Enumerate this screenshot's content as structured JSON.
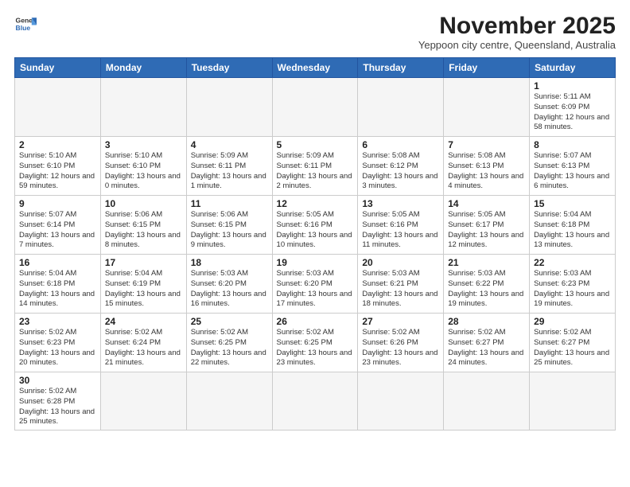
{
  "logo": {
    "line1": "General",
    "line2": "Blue"
  },
  "title": "November 2025",
  "subtitle": "Yeppoon city centre, Queensland, Australia",
  "weekdays": [
    "Sunday",
    "Monday",
    "Tuesday",
    "Wednesday",
    "Thursday",
    "Friday",
    "Saturday"
  ],
  "weeks": [
    [
      {
        "day": "",
        "info": ""
      },
      {
        "day": "",
        "info": ""
      },
      {
        "day": "",
        "info": ""
      },
      {
        "day": "",
        "info": ""
      },
      {
        "day": "",
        "info": ""
      },
      {
        "day": "",
        "info": ""
      },
      {
        "day": "1",
        "info": "Sunrise: 5:11 AM\nSunset: 6:09 PM\nDaylight: 12 hours\nand 58 minutes."
      }
    ],
    [
      {
        "day": "2",
        "info": "Sunrise: 5:10 AM\nSunset: 6:10 PM\nDaylight: 12 hours\nand 59 minutes."
      },
      {
        "day": "3",
        "info": "Sunrise: 5:10 AM\nSunset: 6:10 PM\nDaylight: 13 hours\nand 0 minutes."
      },
      {
        "day": "4",
        "info": "Sunrise: 5:09 AM\nSunset: 6:11 PM\nDaylight: 13 hours\nand 1 minute."
      },
      {
        "day": "5",
        "info": "Sunrise: 5:09 AM\nSunset: 6:11 PM\nDaylight: 13 hours\nand 2 minutes."
      },
      {
        "day": "6",
        "info": "Sunrise: 5:08 AM\nSunset: 6:12 PM\nDaylight: 13 hours\nand 3 minutes."
      },
      {
        "day": "7",
        "info": "Sunrise: 5:08 AM\nSunset: 6:13 PM\nDaylight: 13 hours\nand 4 minutes."
      },
      {
        "day": "8",
        "info": "Sunrise: 5:07 AM\nSunset: 6:13 PM\nDaylight: 13 hours\nand 6 minutes."
      }
    ],
    [
      {
        "day": "9",
        "info": "Sunrise: 5:07 AM\nSunset: 6:14 PM\nDaylight: 13 hours\nand 7 minutes."
      },
      {
        "day": "10",
        "info": "Sunrise: 5:06 AM\nSunset: 6:15 PM\nDaylight: 13 hours\nand 8 minutes."
      },
      {
        "day": "11",
        "info": "Sunrise: 5:06 AM\nSunset: 6:15 PM\nDaylight: 13 hours\nand 9 minutes."
      },
      {
        "day": "12",
        "info": "Sunrise: 5:05 AM\nSunset: 6:16 PM\nDaylight: 13 hours\nand 10 minutes."
      },
      {
        "day": "13",
        "info": "Sunrise: 5:05 AM\nSunset: 6:16 PM\nDaylight: 13 hours\nand 11 minutes."
      },
      {
        "day": "14",
        "info": "Sunrise: 5:05 AM\nSunset: 6:17 PM\nDaylight: 13 hours\nand 12 minutes."
      },
      {
        "day": "15",
        "info": "Sunrise: 5:04 AM\nSunset: 6:18 PM\nDaylight: 13 hours\nand 13 minutes."
      }
    ],
    [
      {
        "day": "16",
        "info": "Sunrise: 5:04 AM\nSunset: 6:18 PM\nDaylight: 13 hours\nand 14 minutes."
      },
      {
        "day": "17",
        "info": "Sunrise: 5:04 AM\nSunset: 6:19 PM\nDaylight: 13 hours\nand 15 minutes."
      },
      {
        "day": "18",
        "info": "Sunrise: 5:03 AM\nSunset: 6:20 PM\nDaylight: 13 hours\nand 16 minutes."
      },
      {
        "day": "19",
        "info": "Sunrise: 5:03 AM\nSunset: 6:20 PM\nDaylight: 13 hours\nand 17 minutes."
      },
      {
        "day": "20",
        "info": "Sunrise: 5:03 AM\nSunset: 6:21 PM\nDaylight: 13 hours\nand 18 minutes."
      },
      {
        "day": "21",
        "info": "Sunrise: 5:03 AM\nSunset: 6:22 PM\nDaylight: 13 hours\nand 19 minutes."
      },
      {
        "day": "22",
        "info": "Sunrise: 5:03 AM\nSunset: 6:23 PM\nDaylight: 13 hours\nand 19 minutes."
      }
    ],
    [
      {
        "day": "23",
        "info": "Sunrise: 5:02 AM\nSunset: 6:23 PM\nDaylight: 13 hours\nand 20 minutes."
      },
      {
        "day": "24",
        "info": "Sunrise: 5:02 AM\nSunset: 6:24 PM\nDaylight: 13 hours\nand 21 minutes."
      },
      {
        "day": "25",
        "info": "Sunrise: 5:02 AM\nSunset: 6:25 PM\nDaylight: 13 hours\nand 22 minutes."
      },
      {
        "day": "26",
        "info": "Sunrise: 5:02 AM\nSunset: 6:25 PM\nDaylight: 13 hours\nand 23 minutes."
      },
      {
        "day": "27",
        "info": "Sunrise: 5:02 AM\nSunset: 6:26 PM\nDaylight: 13 hours\nand 23 minutes."
      },
      {
        "day": "28",
        "info": "Sunrise: 5:02 AM\nSunset: 6:27 PM\nDaylight: 13 hours\nand 24 minutes."
      },
      {
        "day": "29",
        "info": "Sunrise: 5:02 AM\nSunset: 6:27 PM\nDaylight: 13 hours\nand 25 minutes."
      }
    ],
    [
      {
        "day": "30",
        "info": "Sunrise: 5:02 AM\nSunset: 6:28 PM\nDaylight: 13 hours\nand 25 minutes."
      },
      {
        "day": "",
        "info": ""
      },
      {
        "day": "",
        "info": ""
      },
      {
        "day": "",
        "info": ""
      },
      {
        "day": "",
        "info": ""
      },
      {
        "day": "",
        "info": ""
      },
      {
        "day": "",
        "info": ""
      }
    ]
  ]
}
